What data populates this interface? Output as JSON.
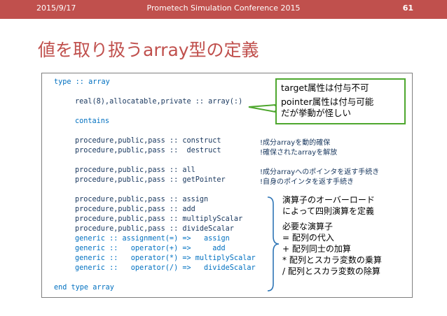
{
  "header": {
    "date": "2015/9/17",
    "conference": "Prometech Simulation Conference 2015",
    "page": "61"
  },
  "title": "値を取り扱うarray型の定義",
  "code": {
    "type_line": "type :: array",
    "real_line": "real(8),allocatable,private :: array(:)",
    "contains": "contains",
    "proc_construct": "procedure,public,pass :: construct",
    "proc_destruct": "procedure,public,pass ::  destruct",
    "proc_all": "procedure,public,pass :: all",
    "proc_getpointer": "procedure,public,pass :: getPointer",
    "proc_assign": "procedure,public,pass :: assign",
    "proc_add": "procedure,public,pass :: add",
    "proc_multiply": "procedure,public,pass :: multiplyScalar",
    "proc_divide": "procedure,public,pass :: divideScalar",
    "gen_assign": "generic :: assignment(=) =>   assign",
    "gen_add": "generic ::   operator(+) =>     add",
    "gen_mul": "generic ::   operator(*) => multiplyScalar",
    "gen_div": "generic ::   operator(/) =>   divideScalar",
    "end_line": "end type array"
  },
  "comments": {
    "construct": "!成分arrayを動的確保",
    "destruct": "!確保されたarrayを解放",
    "all": "!成分arrayへのポインタを返す手続き",
    "getpointer": "!自身のポインタを返す手続き"
  },
  "callout_attributes": {
    "line1": "target属性は付与不可",
    "line2": "pointer属性は付与可能",
    "line3": "だが挙動が怪しい"
  },
  "callout_operators": {
    "line1": "演算子のオーバーロード",
    "line2": "によって四則演算を定義",
    "line3": "必要な演算子",
    "line4": "= 配列の代入",
    "line5": "+ 配列同士の加算",
    "line6": "* 配列とスカラ変数の乗算",
    "line7": "/  配列とスカラ変数の除算"
  },
  "colors": {
    "header_bg": "#c0504d",
    "title": "#c0504d",
    "callout_border": "#4ea72e",
    "brace": "#2e75b6"
  }
}
